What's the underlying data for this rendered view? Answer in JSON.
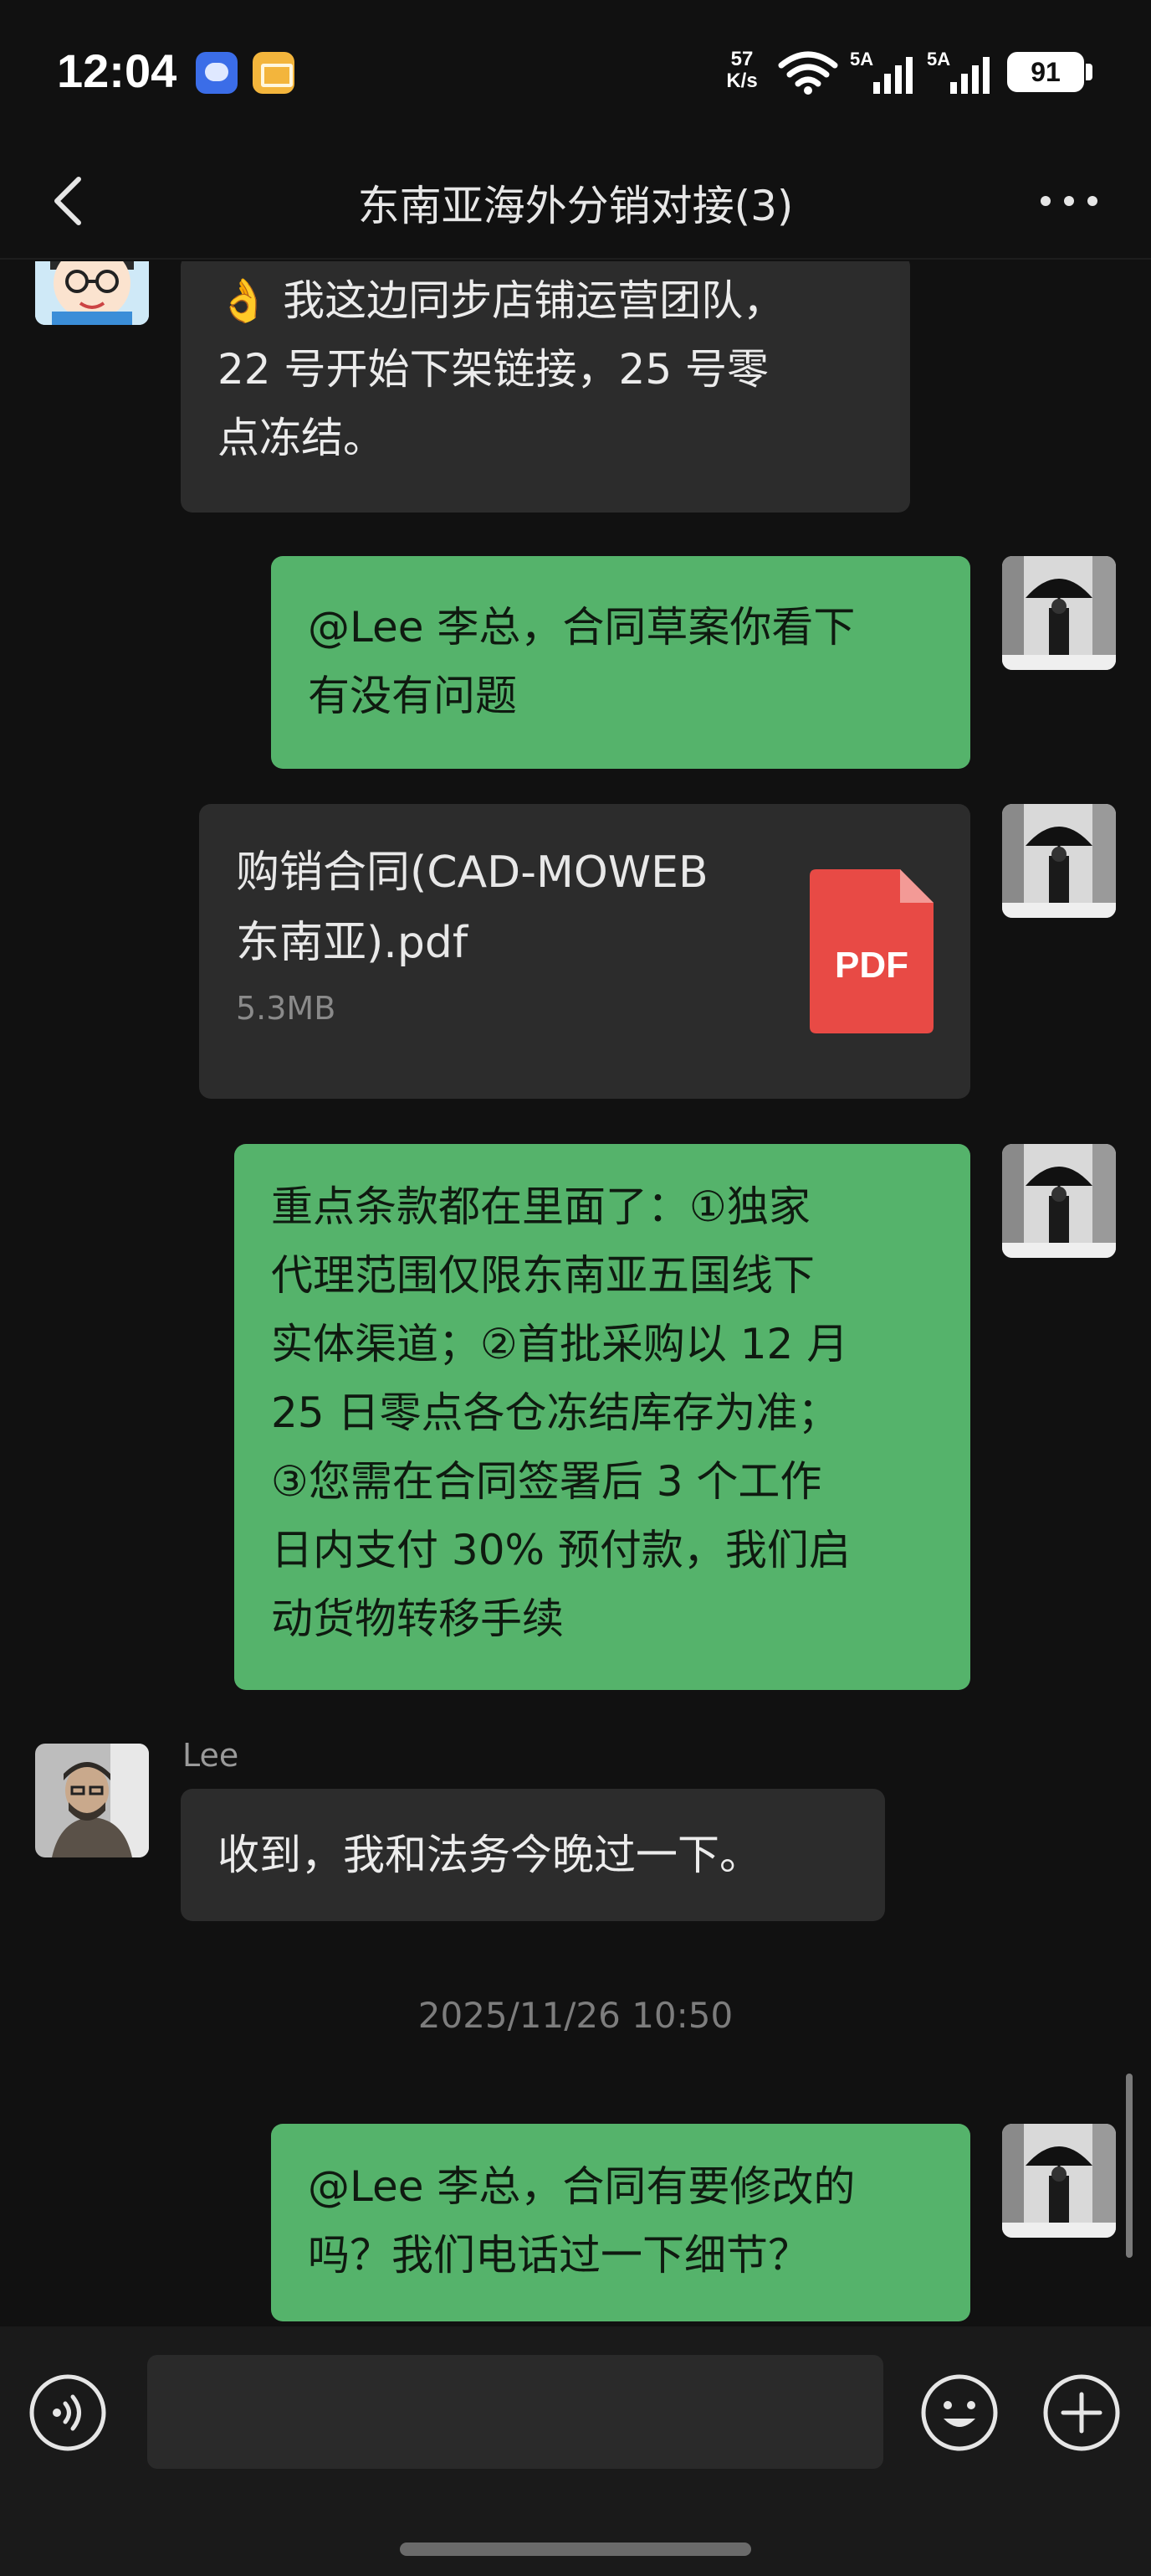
{
  "status_bar": {
    "time": "12:04",
    "notifications": [
      "message-icon",
      "mail-icon"
    ],
    "net_speed_value": "57",
    "net_speed_unit": "K/s",
    "signal1_label": "5A",
    "signal2_label": "5A",
    "battery": "91"
  },
  "header": {
    "title": "东南亚海外分销对接(3)",
    "back_icon": "chevron-left-icon",
    "more_icon": "more-dots-icon"
  },
  "messages": {
    "m1": {
      "direction": "incoming",
      "text_line1": "👌 我这边同步店铺运营团队，",
      "text_line2": "22 号开始下架链接，25 号零",
      "text_line3": "点冻结。"
    },
    "m2": {
      "direction": "outgoing",
      "text_line1": "@Lee 李总，合同草案你看下",
      "text_line2": "有没有问题"
    },
    "m3": {
      "direction": "outgoing",
      "type": "file",
      "file_name_line1": "购销合同(CAD-MOWEB",
      "file_name_line2": "东南亚).pdf",
      "file_size": "5.3MB",
      "file_icon_label": "PDF"
    },
    "m4": {
      "direction": "outgoing",
      "text_line1": "重点条款都在里面了：①独家",
      "text_line2": "代理范围仅限东南亚五国线下",
      "text_line3": "实体渠道；②首批采购以 12 月",
      "text_line4": "25 日零点各仓冻结库存为准；",
      "text_line5": "③您需在合同签署后 3 个工作",
      "text_line6": "日内支付 30% 预付款，我们启",
      "text_line7": "动货物转移手续"
    },
    "m5": {
      "direction": "incoming",
      "sender": "Lee",
      "text": "收到，我和法务今晚过一下。"
    },
    "timestamp": "2025/11/26 10:50",
    "m6": {
      "direction": "outgoing",
      "text_line1": "@Lee 李总，合同有要修改的",
      "text_line2": "吗？我们电话过一下细节？"
    }
  },
  "input_bar": {
    "input_value": "",
    "voice_icon": "voice-icon",
    "emoji_icon": "emoji-icon",
    "plus_icon": "plus-icon"
  },
  "colors": {
    "background": "#111111",
    "incoming_bubble": "#2c2c2c",
    "outgoing_bubble": "#55b36b",
    "pdf_red": "#e84a45"
  }
}
